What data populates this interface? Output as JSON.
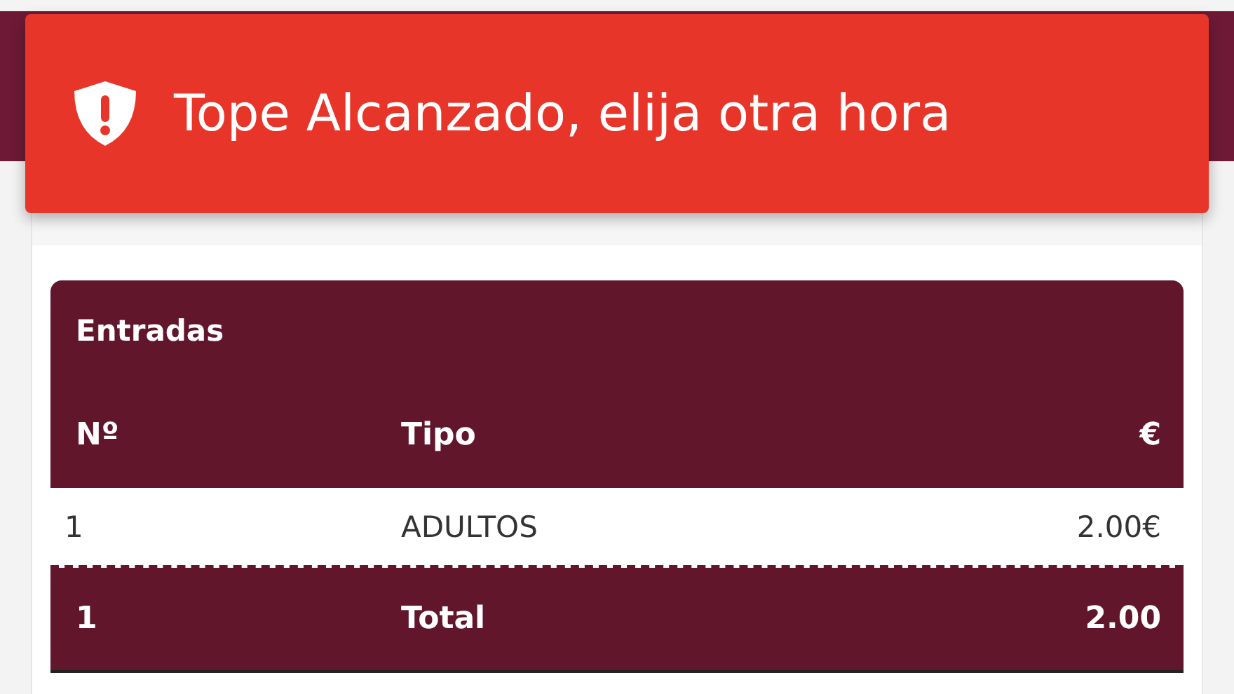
{
  "toast": {
    "message": "Tope Alcanzado, elija otra hora"
  },
  "table": {
    "title": "Entradas",
    "columns": [
      "Nº",
      "Tipo",
      "€"
    ],
    "rows": [
      [
        "1",
        "ADULTOS",
        "2.00€"
      ]
    ],
    "total": [
      "1",
      "Total",
      "2.00"
    ]
  }
}
